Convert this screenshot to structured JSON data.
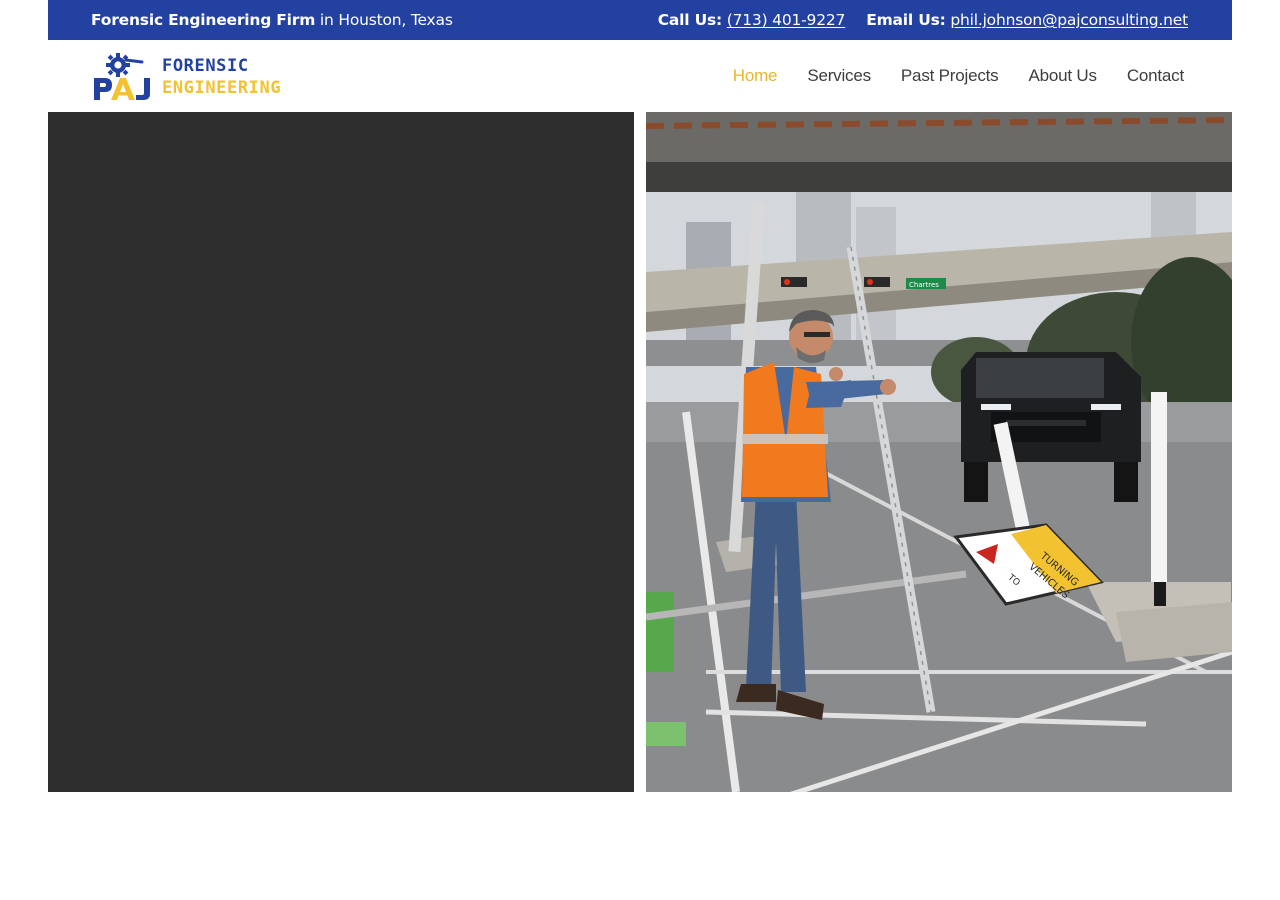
{
  "topbar": {
    "firm_bold": "Forensic Engineering Firm",
    "firm_rest": " in Houston, Texas",
    "call_label": "Call Us:",
    "phone": "(713) 401-9227",
    "email_label": "Email Us:",
    "email": "phil.johnson@pajconsulting.net"
  },
  "logo": {
    "mark_letters": "PAJ",
    "line1": "FORENSIC",
    "line2": "ENGINEERING"
  },
  "nav": {
    "items": [
      {
        "label": "Home",
        "active": true
      },
      {
        "label": "Services",
        "active": false
      },
      {
        "label": "Past Projects",
        "active": false
      },
      {
        "label": "About Us",
        "active": false
      },
      {
        "label": "Contact",
        "active": false
      }
    ]
  },
  "hero": {
    "photo": {
      "street_sign": "Chartres",
      "road_sign_line1": "TURNING",
      "road_sign_line2": "VEHICLES",
      "road_sign_line3": "TO"
    }
  },
  "colors": {
    "brand_blue": "#2341a0",
    "brand_yellow": "#f2c230",
    "nav_active": "#e8b62a",
    "dark_panel": "#2e2e2e"
  }
}
